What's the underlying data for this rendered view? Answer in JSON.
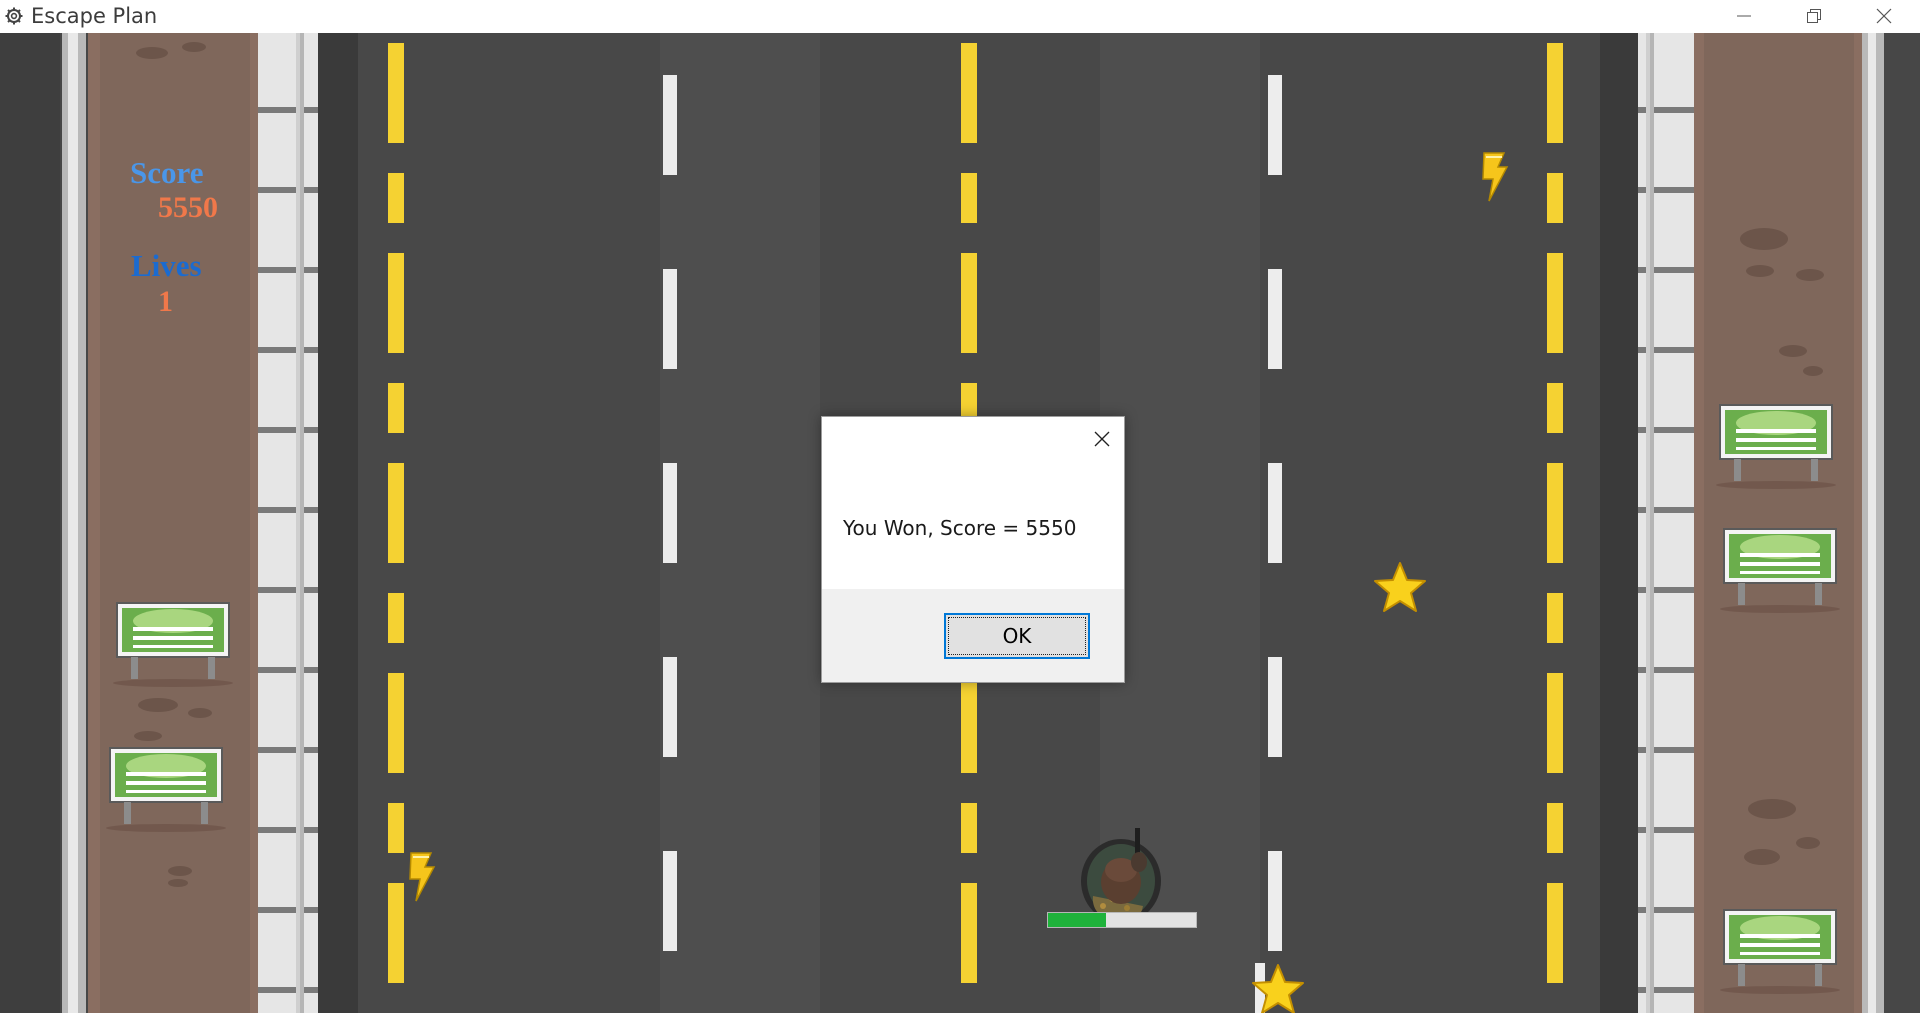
{
  "window": {
    "title": "Escape Plan",
    "icon": "gear-icon",
    "controls": [
      "minimize-icon",
      "restore-icon",
      "close-icon"
    ]
  },
  "hud": {
    "score_label": "Score",
    "score_value": "5550",
    "lives_label": "Lives",
    "lives_value": "1"
  },
  "player": {
    "health_fraction": 0.39,
    "health_color": "#1fb23b"
  },
  "pickups": [
    "lightning-bolt-icon",
    "lightning-bolt-icon",
    "star-icon",
    "star-icon"
  ],
  "dialog": {
    "message": "You Won, Score = 5550",
    "ok_label": "OK",
    "close_icon": "close-icon"
  },
  "colors": {
    "road": "#4a4a4a",
    "lane_yellow": "#f5d232",
    "lane_white": "#ededed",
    "dirt": "#8a6e61",
    "sign_green": "#6bae4c",
    "accent": "#0078d7"
  }
}
